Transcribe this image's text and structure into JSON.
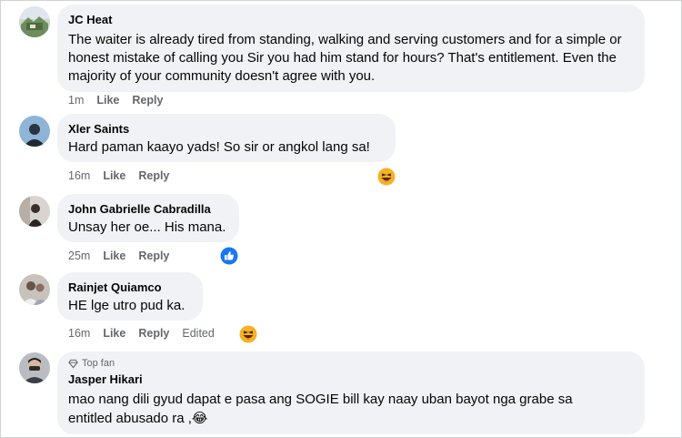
{
  "comments": [
    {
      "name": "JC Heat",
      "text": "The waiter is already tired from standing, walking and serving customers and for a simple or honest mistake of calling you Sir you had him stand for hours? That's entitlement. Even the majority of your community doesn't agree with you.",
      "time": "1m",
      "like_label": "Like",
      "reply_label": "Reply"
    },
    {
      "name": "Xler Saints",
      "text": "Hard paman kaayo yads! So sir or angkol lang sa!",
      "time": "16m",
      "like_label": "Like",
      "reply_label": "Reply",
      "reaction": "haha"
    },
    {
      "name": "John Gabrielle Cabradilla",
      "text": "Unsay her oe... His mana.",
      "time": "25m",
      "like_label": "Like",
      "reply_label": "Reply",
      "reaction": "like"
    },
    {
      "name": "Rainjet Quiamco",
      "text": "HE lge utro pud ka.",
      "time": "16m",
      "like_label": "Like",
      "reply_label": "Reply",
      "edited_label": "Edited",
      "reaction": "haha"
    },
    {
      "badge": "Top fan",
      "name": "Jasper Hikari",
      "text_line1": "mao nang dili gyud dapat e pasa ang SOGIE bill kay naay uban bayot nga grabe sa",
      "text_line2": "entitled abusado ra ,😂"
    }
  ],
  "colors": {
    "bubble": "#f0f2f5",
    "meta_text": "#65676b",
    "like_blue": "#1877f2",
    "haha_yellow": "#f7b125"
  }
}
